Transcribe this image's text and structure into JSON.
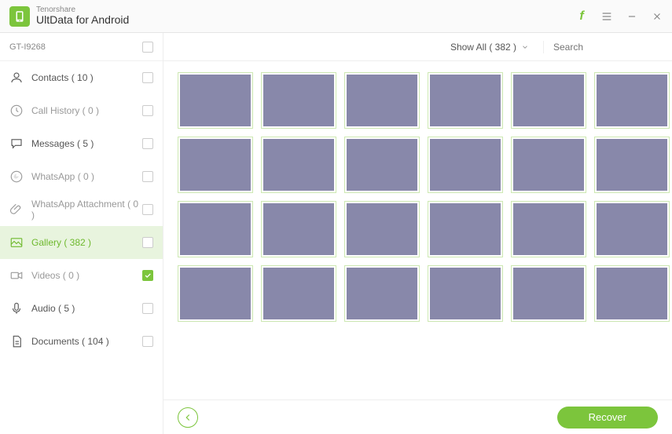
{
  "titlebar": {
    "brand": "Tenorshare",
    "app_name": "UltData for Android"
  },
  "device": {
    "name": "GT-I9268"
  },
  "categories": [
    {
      "id": "contacts",
      "label": "Contacts ( 10 )",
      "enabled": true,
      "checked": false,
      "selected": false,
      "icon": "person"
    },
    {
      "id": "callhist",
      "label": "Call History ( 0 )",
      "enabled": false,
      "checked": false,
      "selected": false,
      "icon": "clock"
    },
    {
      "id": "messages",
      "label": "Messages ( 5 )",
      "enabled": true,
      "checked": false,
      "selected": false,
      "icon": "chat"
    },
    {
      "id": "whatsapp",
      "label": "WhatsApp ( 0 )",
      "enabled": false,
      "checked": false,
      "selected": false,
      "icon": "whatsapp"
    },
    {
      "id": "waattach",
      "label": "WhatsApp Attachment ( 0 )",
      "enabled": false,
      "checked": false,
      "selected": false,
      "icon": "clip"
    },
    {
      "id": "gallery",
      "label": "Gallery ( 382 )",
      "enabled": true,
      "checked": false,
      "selected": true,
      "icon": "image"
    },
    {
      "id": "videos",
      "label": "Videos ( 0 )",
      "enabled": false,
      "checked": true,
      "selected": false,
      "icon": "video"
    },
    {
      "id": "audio",
      "label": "Audio ( 5 )",
      "enabled": true,
      "checked": false,
      "selected": false,
      "icon": "mic"
    },
    {
      "id": "documents",
      "label": "Documents ( 104 )",
      "enabled": true,
      "checked": false,
      "selected": false,
      "icon": "doc"
    }
  ],
  "toolbar": {
    "filter_label": "Show All ( 382 )",
    "search_placeholder": "Search"
  },
  "gallery": {
    "visible_count": 24
  },
  "footer": {
    "recover_label": "Recover"
  },
  "colors": {
    "accent": "#7cc53c"
  }
}
